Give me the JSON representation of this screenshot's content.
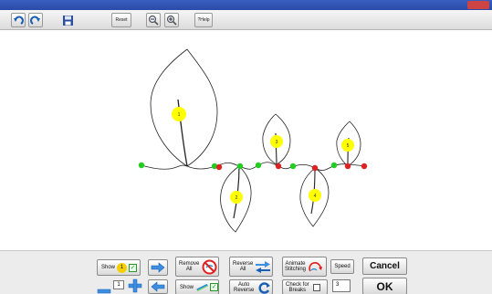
{
  "toolbar": {
    "undo_icon": "undo-icon",
    "redo_icon": "redo-icon",
    "save_icon": "save-icon",
    "reset_label": "Reset",
    "zoom_out_icon": "zoom-out-icon",
    "zoom_in_icon": "zoom-in-icon",
    "help_label": "?Help"
  },
  "canvas": {
    "leaf_labels": [
      "1",
      "2",
      "3",
      "4",
      "5"
    ]
  },
  "bottom": {
    "show_label": "Show",
    "show_badge": "1",
    "show2_label": "Show",
    "remove_all_label_1": "Remove",
    "remove_all_label_2": "All",
    "reverse_all_label_1": "Reverse",
    "reverse_all_label_2": "All",
    "auto_reverse_label_1": "Auto",
    "auto_reverse_label_2": "Reverse",
    "animate_label_1": "Animate",
    "animate_label_2": "Stitching",
    "speed_label": "Speed",
    "check_breaks_label_1": "Check for",
    "check_breaks_label_2": "Breaks",
    "breaks_value": "3",
    "stepper_value": "1",
    "cancel_label": "Cancel",
    "ok_label": "OK"
  }
}
